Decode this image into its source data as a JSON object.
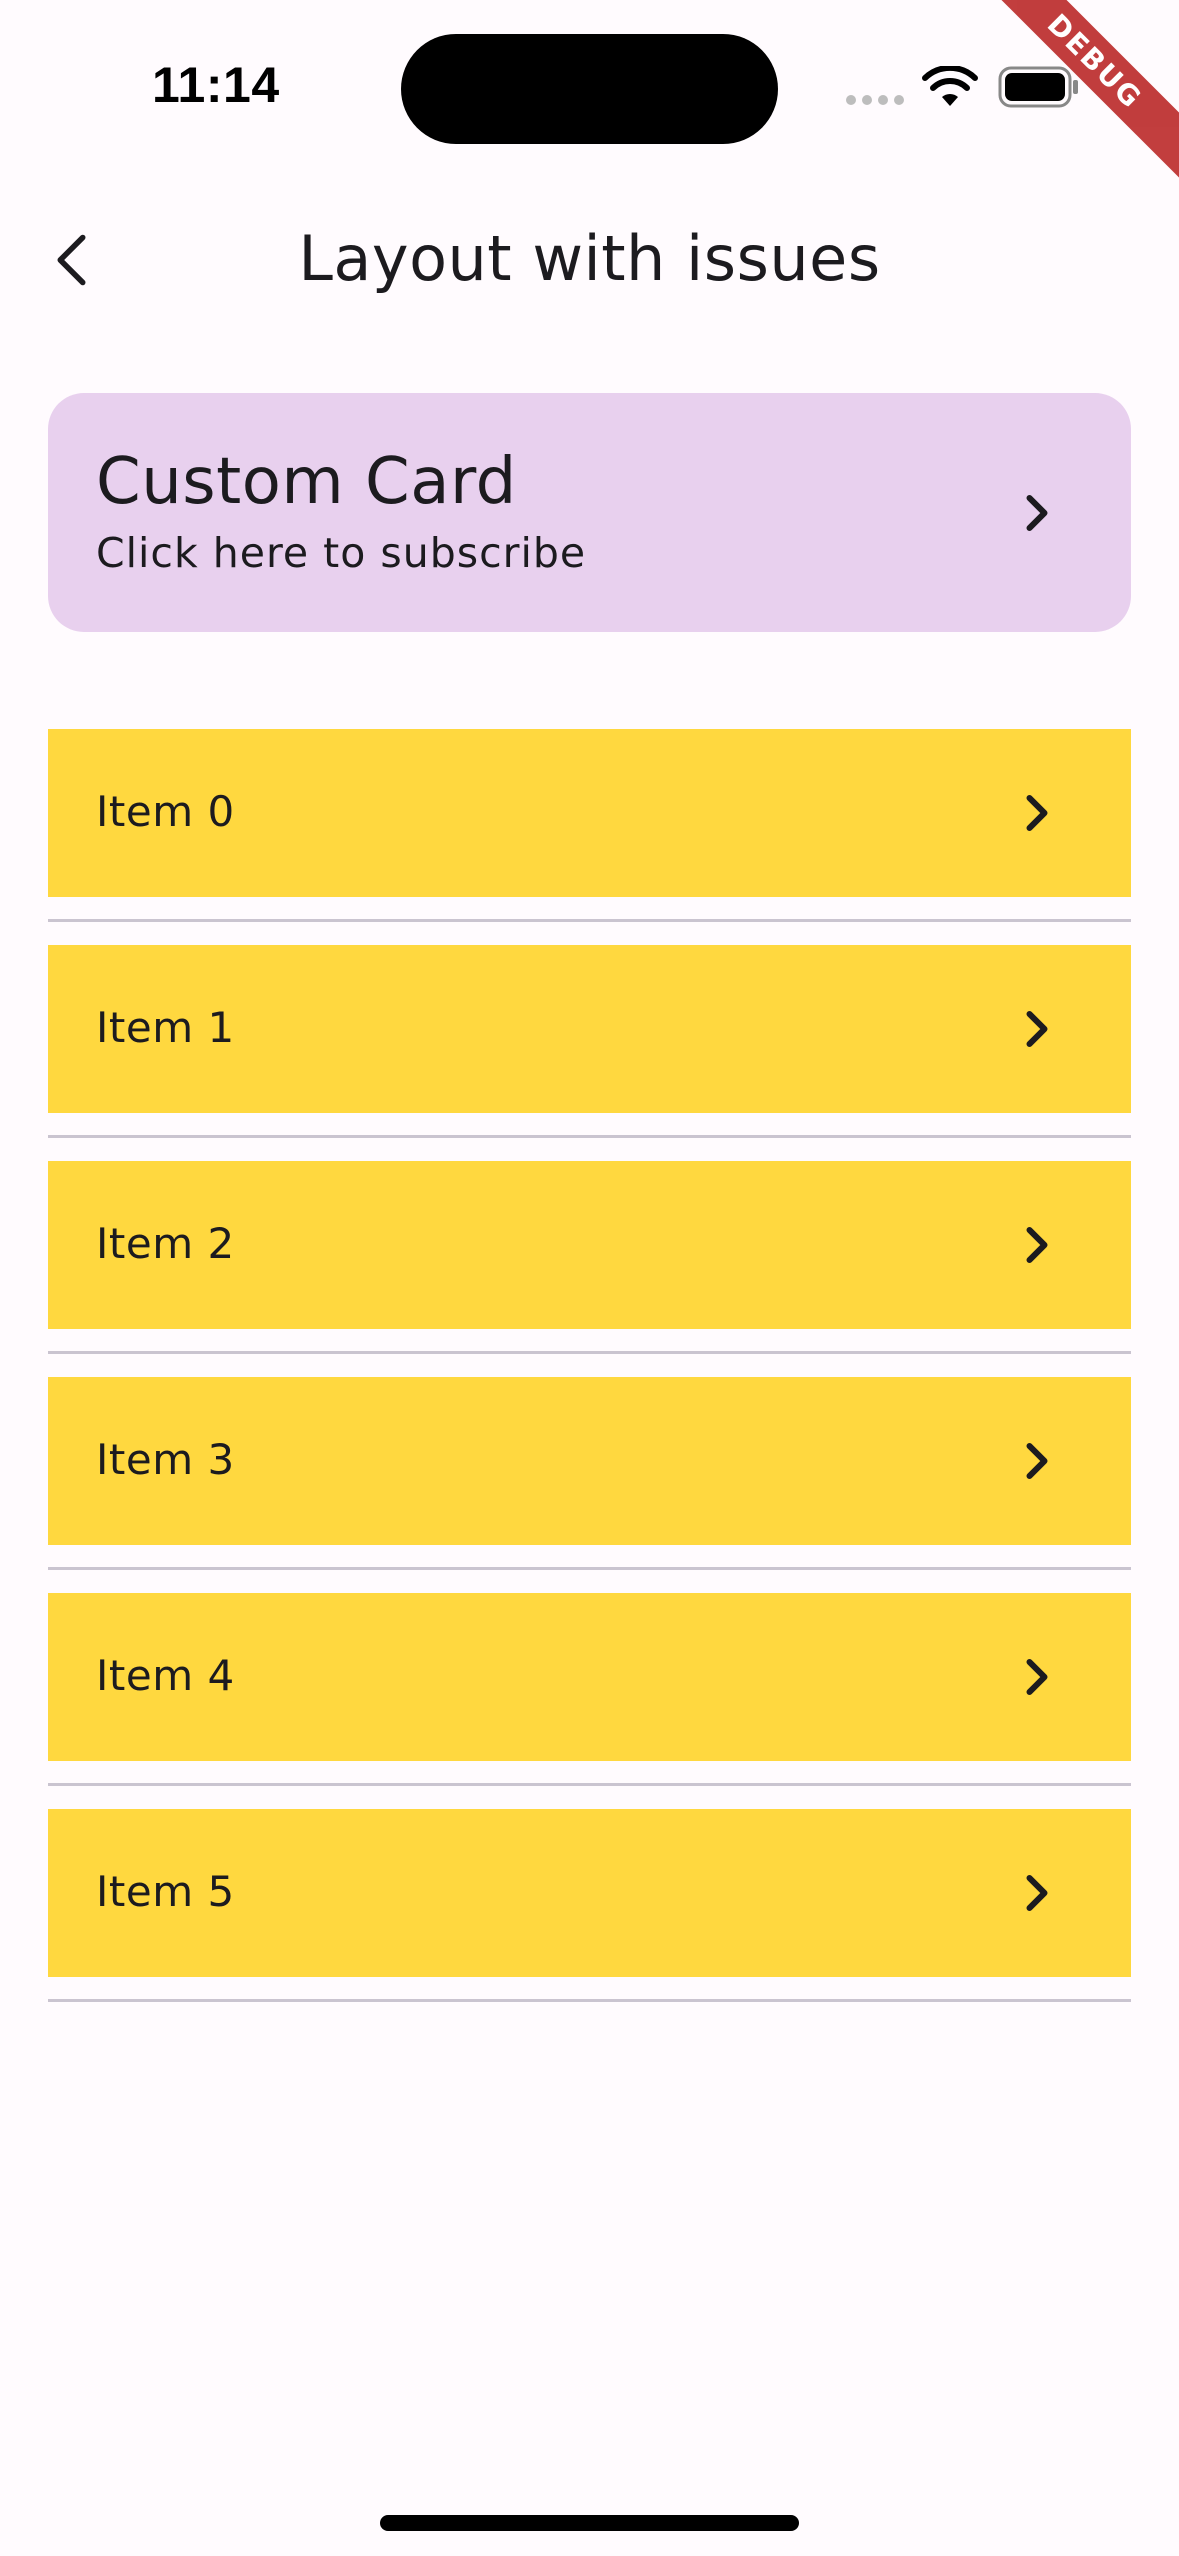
{
  "status_bar": {
    "time": "11:14"
  },
  "debug_banner": {
    "label": "DEBUG",
    "color": "#B71C1C"
  },
  "app_bar": {
    "title": "Layout with issues",
    "back_icon": "chevron-left-icon"
  },
  "custom_card": {
    "title": "Custom Card",
    "subtitle": "Click here to subscribe",
    "icon": "chevron-right-icon",
    "background": "#E8D0EE"
  },
  "list": {
    "item_background": "#FFD83F",
    "divider_color": "#CAC4D0",
    "items": [
      {
        "label": "Item 0"
      },
      {
        "label": "Item 1"
      },
      {
        "label": "Item 2"
      },
      {
        "label": "Item 3"
      },
      {
        "label": "Item 4"
      },
      {
        "label": "Item 5"
      }
    ]
  }
}
